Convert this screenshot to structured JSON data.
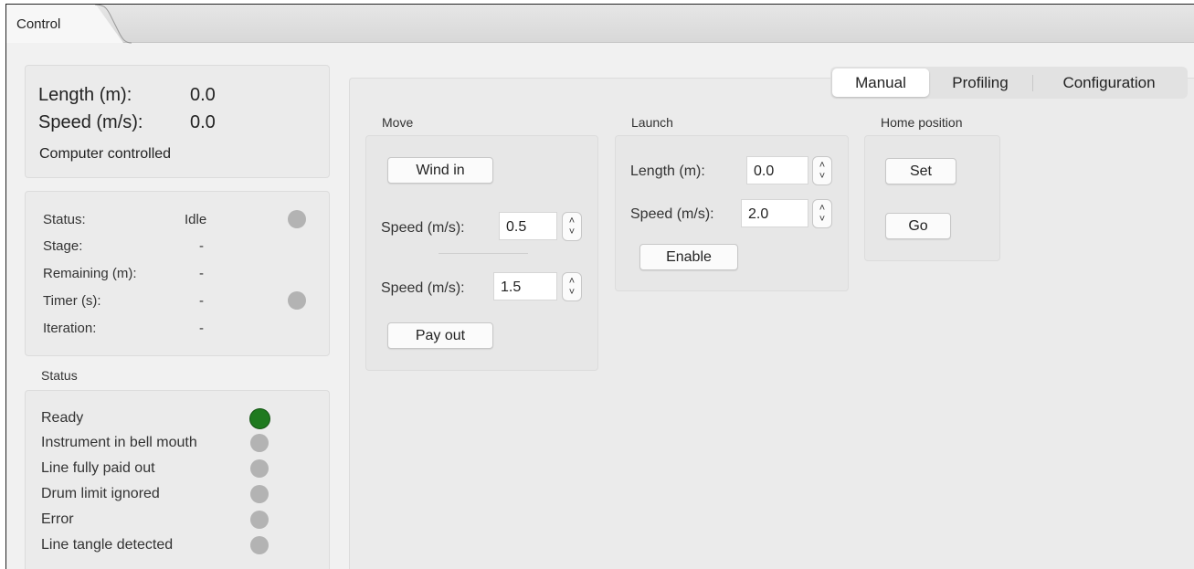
{
  "window": {
    "tab_label": "Control"
  },
  "readout": {
    "length_label": "Length (m):",
    "length_value": "0.0",
    "speed_label": "Speed (m/s):",
    "speed_value": "0.0",
    "mode": "Computer controlled"
  },
  "process": {
    "rows": [
      {
        "label": "Status:",
        "value": "Idle"
      },
      {
        "label": "Stage:",
        "value": "-"
      },
      {
        "label": "Remaining (m):",
        "value": "-"
      },
      {
        "label": "Timer (s):",
        "value": "-"
      },
      {
        "label": "Iteration:",
        "value": "-"
      }
    ]
  },
  "status": {
    "title": "Status",
    "items": [
      {
        "label": "Ready",
        "state": "on",
        "color": "#1f7a1f"
      },
      {
        "label": "Instrument in bell mouth",
        "state": "off",
        "color": "#b3b3b3"
      },
      {
        "label": "Line fully paid out",
        "state": "off",
        "color": "#b3b3b3"
      },
      {
        "label": "Drum limit ignored",
        "state": "off",
        "color": "#b3b3b3"
      },
      {
        "label": "Error",
        "state": "off",
        "color": "#b3b3b3"
      },
      {
        "label": "Line tangle detected",
        "state": "off",
        "color": "#b3b3b3"
      }
    ]
  },
  "mode_tabs": {
    "items": [
      "Manual",
      "Profiling",
      "Configuration"
    ],
    "selected": "Manual"
  },
  "move": {
    "title": "Move",
    "wind_in_label": "Wind in",
    "speed_in_label": "Speed (m/s):",
    "speed_in_value": "0.5",
    "speed_out_label": "Speed (m/s):",
    "speed_out_value": "1.5",
    "pay_out_label": "Pay out"
  },
  "launch": {
    "title": "Launch",
    "length_label": "Length (m):",
    "length_value": "0.0",
    "speed_label": "Speed (m/s):",
    "speed_value": "2.0",
    "enable_label": "Enable"
  },
  "home": {
    "title": "Home position",
    "set_label": "Set",
    "go_label": "Go"
  }
}
